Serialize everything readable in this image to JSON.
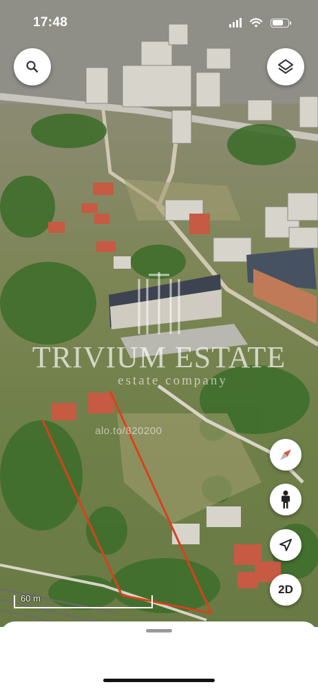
{
  "status_bar": {
    "time": "17:48",
    "signal_bars": 4,
    "battery_level": 0.75
  },
  "map_controls": {
    "search_icon": "search-icon",
    "layers_icon": "layers-icon",
    "compass_icon": "compass-icon",
    "street_view_icon": "pegman-icon",
    "my_location_icon": "navigation-arrow-icon",
    "view_mode_label": "2D"
  },
  "watermark": {
    "title": "TRIVIUM ESTATE",
    "subtitle": "estate company",
    "listing_id": "alo.to/820200"
  },
  "scale": {
    "label": "60 m"
  },
  "colors": {
    "plot_boundary": "#d6421d",
    "compass_north": "#e0533a",
    "button_bg": "#ffffff"
  }
}
